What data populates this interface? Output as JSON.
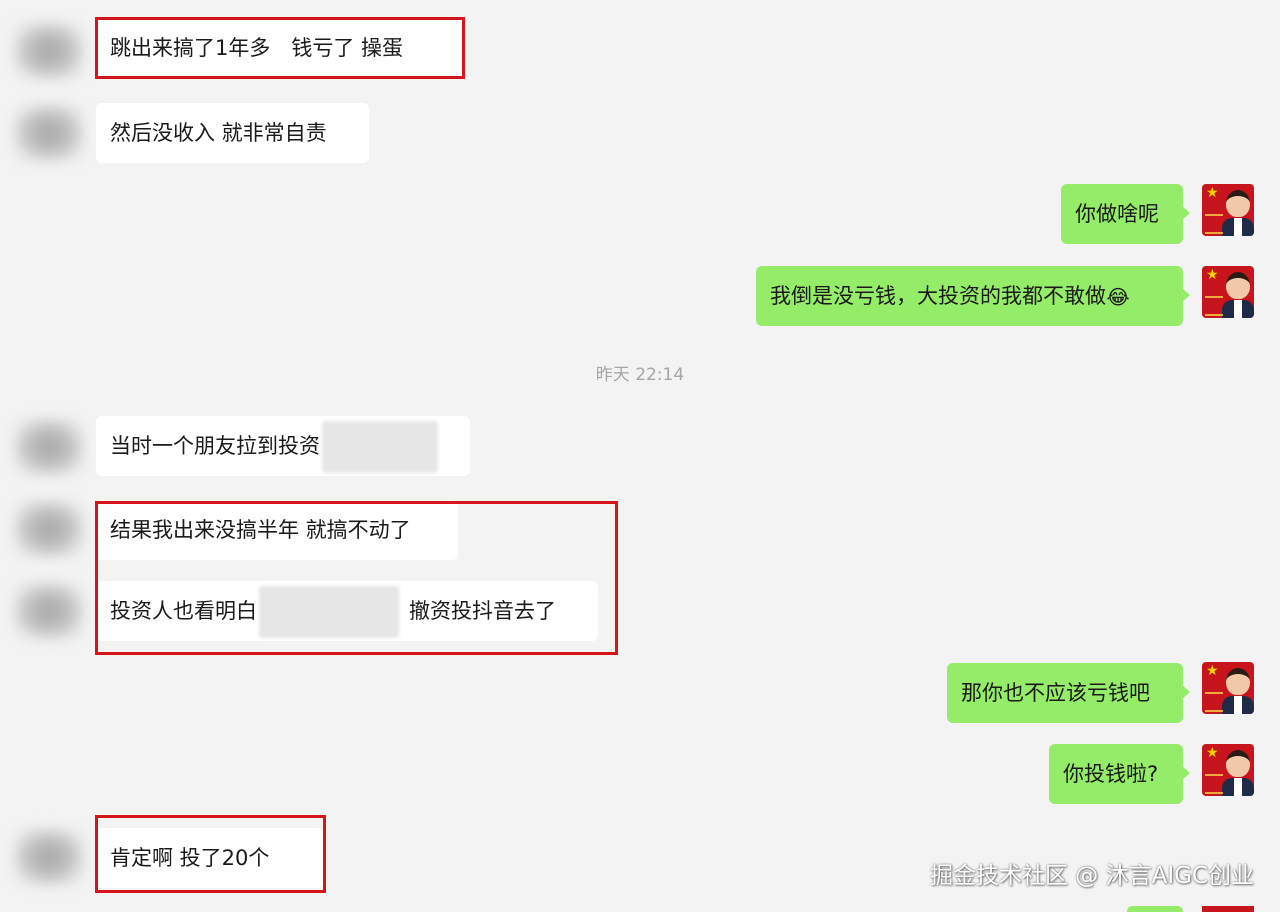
{
  "chat": {
    "timestamp": "昨天 22:14",
    "messages": [
      {
        "side": "in",
        "text": "跳出来搞了1年多　钱亏了  操蛋"
      },
      {
        "side": "in",
        "text": "然后没收入  就非常自责"
      },
      {
        "side": "out",
        "text": "你做啥呢"
      },
      {
        "side": "out",
        "text": "我倒是没亏钱，大投资的我都不敢做",
        "emoji": "😂"
      },
      {
        "side": "in",
        "text": "当时一个朋友拉到投资"
      },
      {
        "side": "in",
        "text": "结果我出来没搞半年  就搞不动了"
      },
      {
        "side": "in",
        "text_before": "投资人也看明白",
        "text_after": "撤资投抖音去了"
      },
      {
        "side": "out",
        "text": "那你也不应该亏钱吧"
      },
      {
        "side": "out",
        "text": "你投钱啦?"
      },
      {
        "side": "in",
        "text": "肯定啊  投了20个"
      }
    ]
  },
  "watermark": "掘金技术社区 @ 沐言AIGC创业",
  "colors": {
    "background": "#f3f3f3",
    "incoming_bubble": "#ffffff",
    "outgoing_bubble": "#95ec69",
    "highlight_box": "#d8141b"
  },
  "icons": {
    "contact_avatar": "blurred-avatar",
    "self_avatar": "photo-avatar"
  }
}
